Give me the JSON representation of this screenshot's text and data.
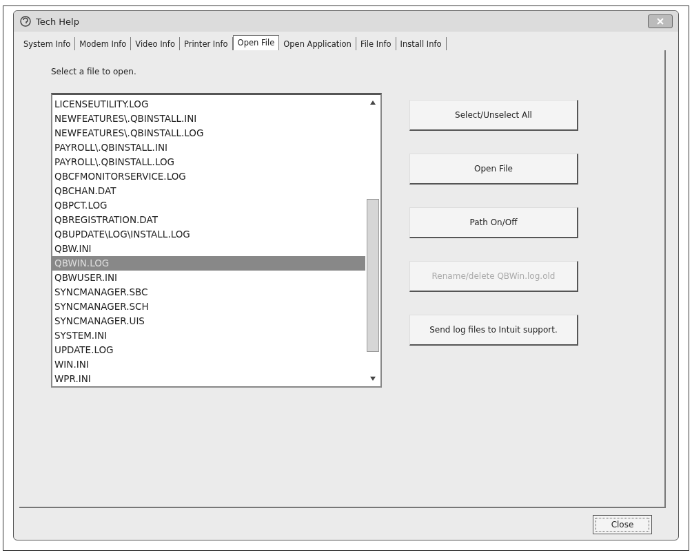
{
  "window": {
    "title": "Tech Help"
  },
  "tabs": [
    {
      "label": "System Info",
      "selected": false
    },
    {
      "label": "Modem Info",
      "selected": false
    },
    {
      "label": "Video Info",
      "selected": false
    },
    {
      "label": "Printer Info",
      "selected": false
    },
    {
      "label": "Open File",
      "selected": true
    },
    {
      "label": "Open Application",
      "selected": false
    },
    {
      "label": "File Info",
      "selected": false
    },
    {
      "label": "Install Info",
      "selected": false
    }
  ],
  "prompt": "Select a file to open.",
  "files": [
    {
      "name": "LICENSEUTILITY.LOG",
      "selected": false
    },
    {
      "name": "NEWFEATURES\\.QBINSTALL.INI",
      "selected": false
    },
    {
      "name": "NEWFEATURES\\.QBINSTALL.LOG",
      "selected": false
    },
    {
      "name": "PAYROLL\\.QBINSTALL.INI",
      "selected": false
    },
    {
      "name": "PAYROLL\\.QBINSTALL.LOG",
      "selected": false
    },
    {
      "name": "QBCFMONITORSERVICE.LOG",
      "selected": false
    },
    {
      "name": "QBCHAN.DAT",
      "selected": false
    },
    {
      "name": "QBPCT.LOG",
      "selected": false
    },
    {
      "name": "QBREGISTRATION.DAT",
      "selected": false
    },
    {
      "name": "QBUPDATE\\LOG\\INSTALL.LOG",
      "selected": false
    },
    {
      "name": "QBW.INI",
      "selected": false
    },
    {
      "name": "QBWIN.LOG",
      "selected": true
    },
    {
      "name": "QBWUSER.INI",
      "selected": false
    },
    {
      "name": "SYNCMANAGER.SBC",
      "selected": false
    },
    {
      "name": "SYNCMANAGER.SCH",
      "selected": false
    },
    {
      "name": "SYNCMANAGER.UIS",
      "selected": false
    },
    {
      "name": "SYSTEM.INI",
      "selected": false
    },
    {
      "name": "UPDATE.LOG",
      "selected": false
    },
    {
      "name": "WIN.INI",
      "selected": false
    },
    {
      "name": "WPR.INI",
      "selected": false
    }
  ],
  "actions": [
    {
      "label": "Select/Unselect All",
      "disabled": false
    },
    {
      "label": "Open File",
      "disabled": false
    },
    {
      "label": "Path On/Off",
      "disabled": false
    },
    {
      "label": "Rename/delete QBWin.log.old",
      "disabled": true
    },
    {
      "label": "Send log files to Intuit support.",
      "disabled": false
    }
  ],
  "close_button": "Close"
}
